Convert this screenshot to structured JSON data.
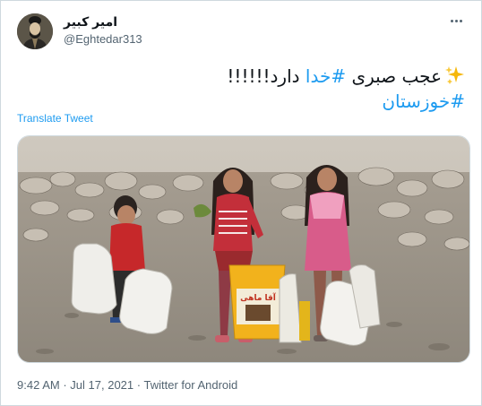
{
  "user": {
    "display_name": "امیر کبیر",
    "handle": "@Eghtedar313"
  },
  "tweet": {
    "text": "عجب صبری #خدا دارد!!!!!!",
    "text_plain_part": "عجب صبری ",
    "hashtag_1": "#خدا",
    "text_after": " دارد!!!!!!",
    "hashtag_2": "#خوزستان",
    "emoji": "sparkles-icon"
  },
  "translate_label": "Translate Tweet",
  "media": {
    "bucket_label": "آقا ماهی"
  },
  "meta": {
    "time": "9:42 AM",
    "date": "Jul 17, 2021",
    "source": "Twitter for Android",
    "separator": "·"
  },
  "colors": {
    "link": "#1d9bf0",
    "secondary_text": "#536471",
    "border": "#cfd9de"
  }
}
